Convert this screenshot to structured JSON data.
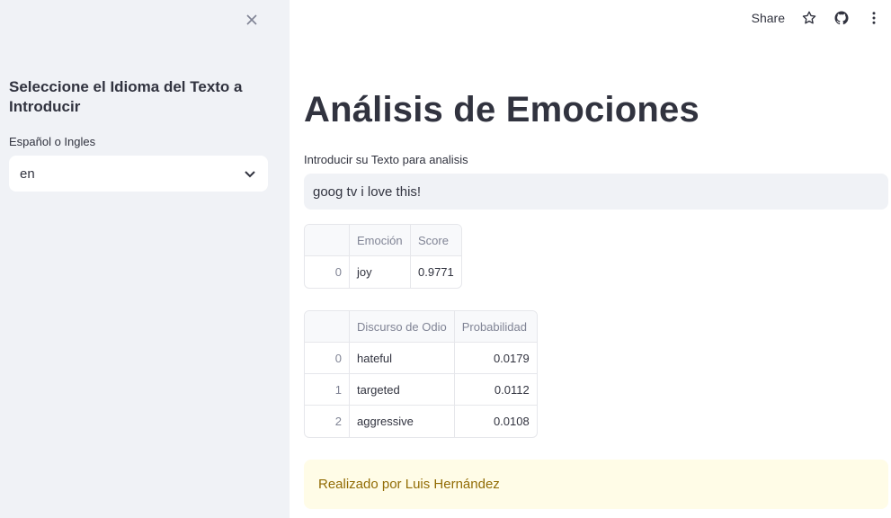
{
  "sidebar": {
    "close_icon": "close-icon",
    "heading": "Seleccione el Idioma del Texto a Introducir",
    "select": {
      "label": "Español o Ingles",
      "value": "en"
    }
  },
  "toolbar": {
    "share_label": "Share",
    "icons": [
      "star-icon",
      "github-icon",
      "more-vert-icon"
    ]
  },
  "main": {
    "title": "Análisis de Emociones",
    "input": {
      "label": "Introducir su Texto para analisis",
      "value": "goog tv i love this!"
    },
    "emotion_table": {
      "headers": [
        "",
        "Emoción",
        "Score"
      ],
      "rows": [
        [
          "0",
          "joy",
          "0.9771"
        ]
      ]
    },
    "hate_table": {
      "headers": [
        "",
        "Discurso de Odio",
        "Probabilidad"
      ],
      "rows": [
        [
          "0",
          "hateful",
          "0.0179"
        ],
        [
          "1",
          "targeted",
          "0.0112"
        ],
        [
          "2",
          "aggressive",
          "0.0108"
        ]
      ]
    },
    "footer_message": "Realizado por Luis Hernández"
  },
  "colors": {
    "sidebar_bg": "#f0f2f6",
    "text": "#31333f",
    "muted": "#808495",
    "success_bg": "#fffce7",
    "success_text": "#926c05"
  }
}
